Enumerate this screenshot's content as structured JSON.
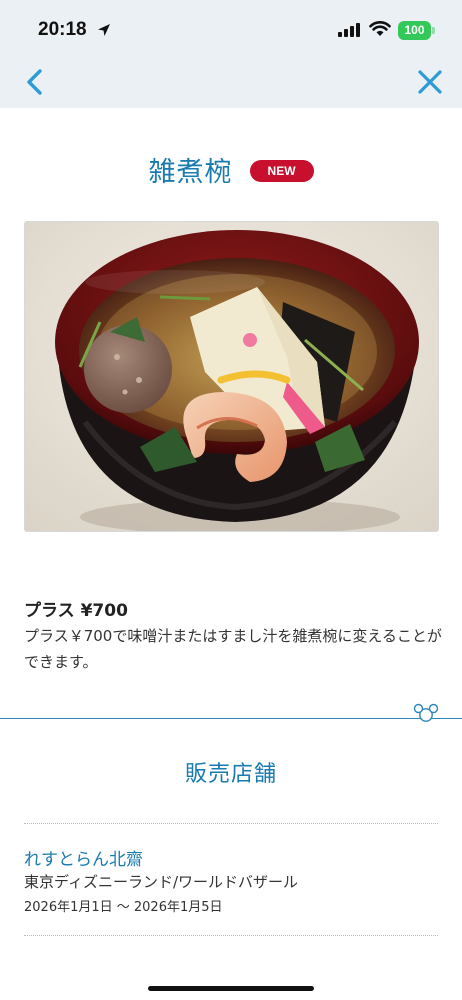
{
  "status_bar": {
    "time": "20:18",
    "battery": "100",
    "icons": [
      "location-arrow-icon",
      "signal-icon",
      "wifi-icon",
      "battery-icon"
    ]
  },
  "nav": {
    "back_icon": "chevron-left-icon",
    "close_icon": "close-icon",
    "accent_color": "#2e9bd6"
  },
  "item": {
    "title": "雑煮椀",
    "badge": "NEW",
    "badge_color": "#c8102e",
    "title_color": "#1a7bb0"
  },
  "price": {
    "heading": "プラス ¥700",
    "description": "プラス￥700で味噌汁またはすまし汁を雑煮椀に変えることができます。"
  },
  "shops": {
    "section_title": "販売店舗",
    "items": [
      {
        "name": "れすとらん北齋",
        "location": "東京ディズニーランド/ワールドバザール",
        "dates": "2026年1月1日 〜 2026年1月5日"
      }
    ]
  }
}
